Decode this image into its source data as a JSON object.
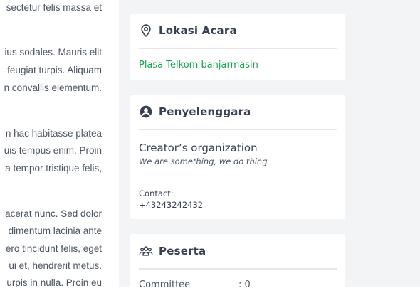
{
  "description": {
    "lines": [
      "sectetur felis massa et",
      "",
      "ius sodales. Mauris elit",
      "feugiat turpis. Aliquam",
      "n convallis elementum.",
      "",
      "n hac habitasse platea",
      "uis tempus enim. Proin",
      "a tempor tristique felis,",
      "",
      "acerat nunc. Sed dolor",
      "dimentum lacinia ante",
      "ero tincidunt felis, eget",
      "ui et, hendrerit metus.",
      "urpis in nulla. Proin eu"
    ]
  },
  "location": {
    "title": "Lokasi Acara",
    "icon": "map-pin-icon",
    "value": "Plasa Telkom banjarmasin",
    "value_color": "#16a34a"
  },
  "organizer": {
    "title": "Penyelenggara",
    "icon": "user-circle-icon",
    "name": "Creator’s organization",
    "tagline": "We are something, we do thing",
    "contact_label": "Contact:",
    "contact_value": "+43243242432"
  },
  "participants": {
    "title": "Peserta",
    "icon": "users-icon",
    "rows": [
      {
        "label": "Committee",
        "value": ": 0"
      }
    ]
  },
  "colors": {
    "background": "#f3f4f6",
    "card": "#ffffff",
    "divider": "#e5e7eb",
    "accent_green": "#16a34a"
  }
}
